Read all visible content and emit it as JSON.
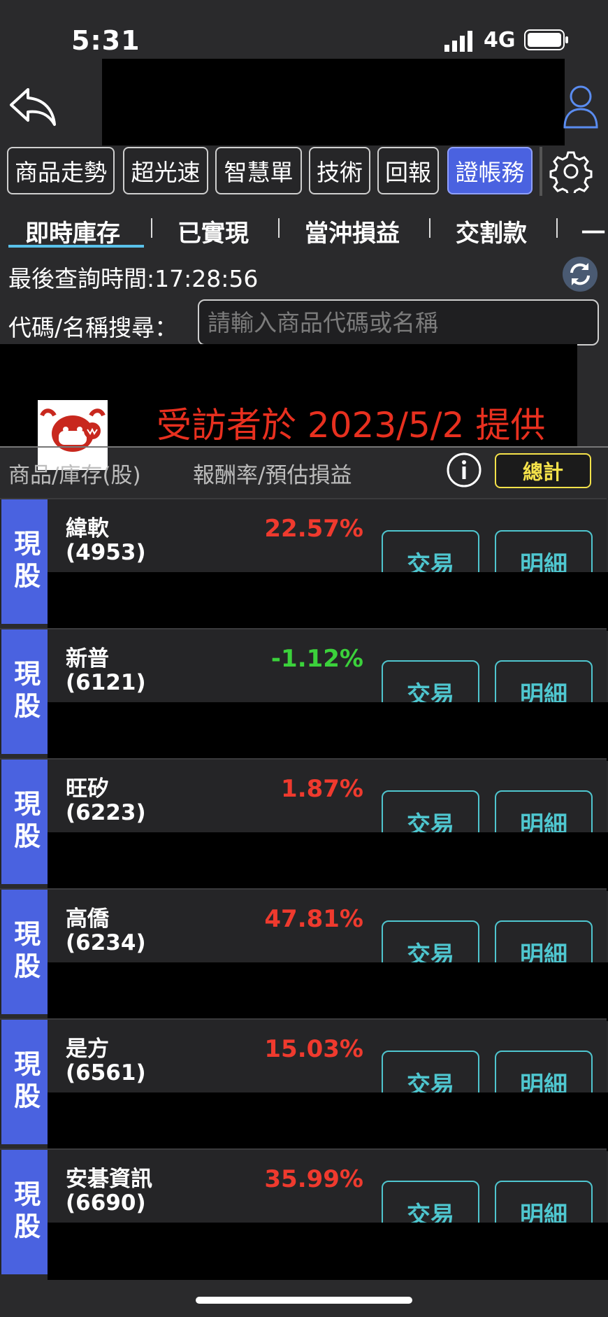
{
  "status": {
    "time": "5:31",
    "network": "4G"
  },
  "toolbar": {
    "buttons": [
      {
        "label": "商品走勢"
      },
      {
        "label": "超光速"
      },
      {
        "label": "智慧單"
      },
      {
        "label": "技術"
      },
      {
        "label": "回報"
      },
      {
        "label": "證帳務",
        "active": true
      }
    ]
  },
  "tabs": [
    {
      "label": "即時庫存",
      "active": true
    },
    {
      "label": "已實現"
    },
    {
      "label": "當沖損益"
    },
    {
      "label": "交割款"
    },
    {
      "label": "一"
    }
  ],
  "query": {
    "last_time_label": "最後查詢時間:17:28:56"
  },
  "search": {
    "label": "代碼/名稱搜尋：",
    "placeholder": "請輸入商品代碼或名稱"
  },
  "watermark": {
    "text": "受訪者於 2023/5/2 提供"
  },
  "columns": {
    "left": "商品/庫存(股)",
    "mid": "報酬率/預估損益",
    "total_label": "總計"
  },
  "holdings": [
    {
      "type": "現股",
      "name": "緯軟",
      "code": "(4953)",
      "pct": "22.57%",
      "trend": "up"
    },
    {
      "type": "現股",
      "name": "新普",
      "code": "(6121)",
      "pct": "-1.12%",
      "trend": "down"
    },
    {
      "type": "現股",
      "name": "旺矽",
      "code": "(6223)",
      "pct": "1.87%",
      "trend": "up"
    },
    {
      "type": "現股",
      "name": "高僑",
      "code": "(6234)",
      "pct": "47.81%",
      "trend": "up"
    },
    {
      "type": "現股",
      "name": "是方",
      "code": "(6561)",
      "pct": "15.03%",
      "trend": "up"
    },
    {
      "type": "現股",
      "name": "安碁資訊",
      "code": "(6690)",
      "pct": "35.99%",
      "trend": "up"
    }
  ],
  "row_actions": {
    "trade": "交易",
    "detail": "明細"
  },
  "colors": {
    "accent": "#4a62e0",
    "up": "#ef3a2e",
    "down": "#3bd13b",
    "button_outline": "#4fc6cf",
    "total": "#f5e24a"
  }
}
